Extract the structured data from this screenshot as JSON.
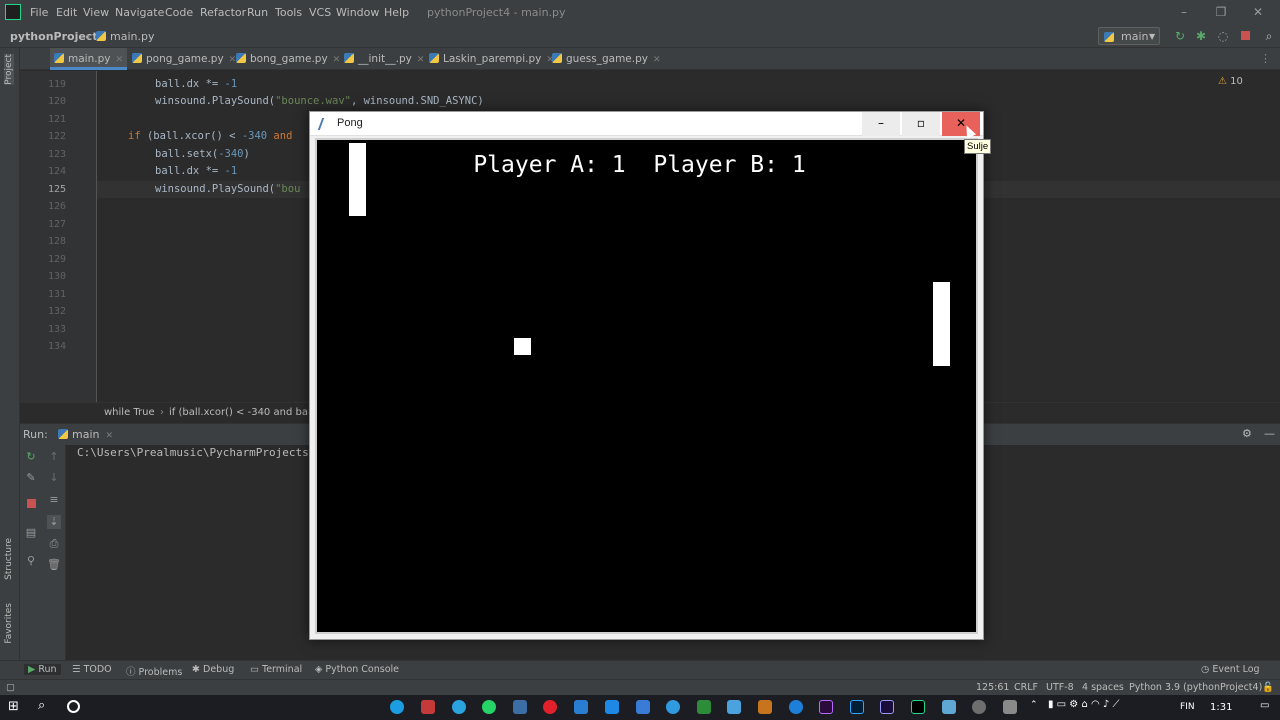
{
  "menu": {
    "items": [
      "File",
      "Edit",
      "View",
      "Navigate",
      "Code",
      "Refactor",
      "Run",
      "Tools",
      "VCS",
      "Window",
      "Help"
    ],
    "window_title": "pythonProject4 - main.py"
  },
  "navbar": {
    "project": "pythonProject4",
    "file": "main.py",
    "run_config": "main"
  },
  "left_strip": {
    "project": "Project",
    "structure": "Structure",
    "favorites": "Favorites"
  },
  "tabs": [
    "main.py",
    "pong_game.py",
    "bong_game.py",
    "__init__.py",
    "Laskin_parempi.py",
    "guess_game.py"
  ],
  "editor": {
    "warnings": "10",
    "line_numbers": [
      "119",
      "120",
      "121",
      "122",
      "123",
      "124",
      "125",
      "126",
      "127",
      "128",
      "129",
      "130",
      "131",
      "132",
      "133",
      "134"
    ],
    "code": {
      "l119": {
        "a": "ball.dx *= ",
        "b": "-1"
      },
      "l120": {
        "a": "winsound.PlaySound(",
        "b": "\"bounce.wav\"",
        "c": ", winsound.SND_ASYNC)"
      },
      "l122": {
        "a": "if",
        "b": " (ball.xcor() < ",
        "c": "-340",
        "d": " and"
      },
      "l123": {
        "a": "ball.setx(",
        "b": "-340",
        "c": ")"
      },
      "l124": {
        "a": "ball.dx *= ",
        "b": "-1"
      },
      "l125": {
        "a": "winsound.PlaySound(",
        "b": "\"bou"
      }
    },
    "breadcrumb": [
      "while True",
      "if (ball.xcor() < -340 and ball..."
    ]
  },
  "run": {
    "label": "Run:",
    "tab": "main",
    "console": "C:\\Users\\Prealmusic\\PycharmProjects"
  },
  "tool_tabs": [
    "Run",
    "TODO",
    "Problems",
    "Debug",
    "Terminal",
    "Python Console"
  ],
  "event_log": "Event Log",
  "status": {
    "position": "125:61",
    "line_sep": "CRLF",
    "encoding": "UTF-8",
    "indent": "4 spaces",
    "interpreter": "Python 3.9 (pythonProject4)"
  },
  "taskbar": {
    "lang": "FIN",
    "time": "1:31"
  },
  "pong": {
    "title": "Pong",
    "score": "Player A: 1  Player B: 1",
    "tooltip": "Sulje",
    "minimize_glyph": "–",
    "maximize_glyph": "▫",
    "close_glyph": "✕"
  },
  "colors": {
    "ide_bg": "#2b2b2b",
    "ide_panel": "#3c3f41",
    "keyword": "#cc7832",
    "number": "#6897bb",
    "string": "#6a8759",
    "close_hover": "#e8615a"
  }
}
